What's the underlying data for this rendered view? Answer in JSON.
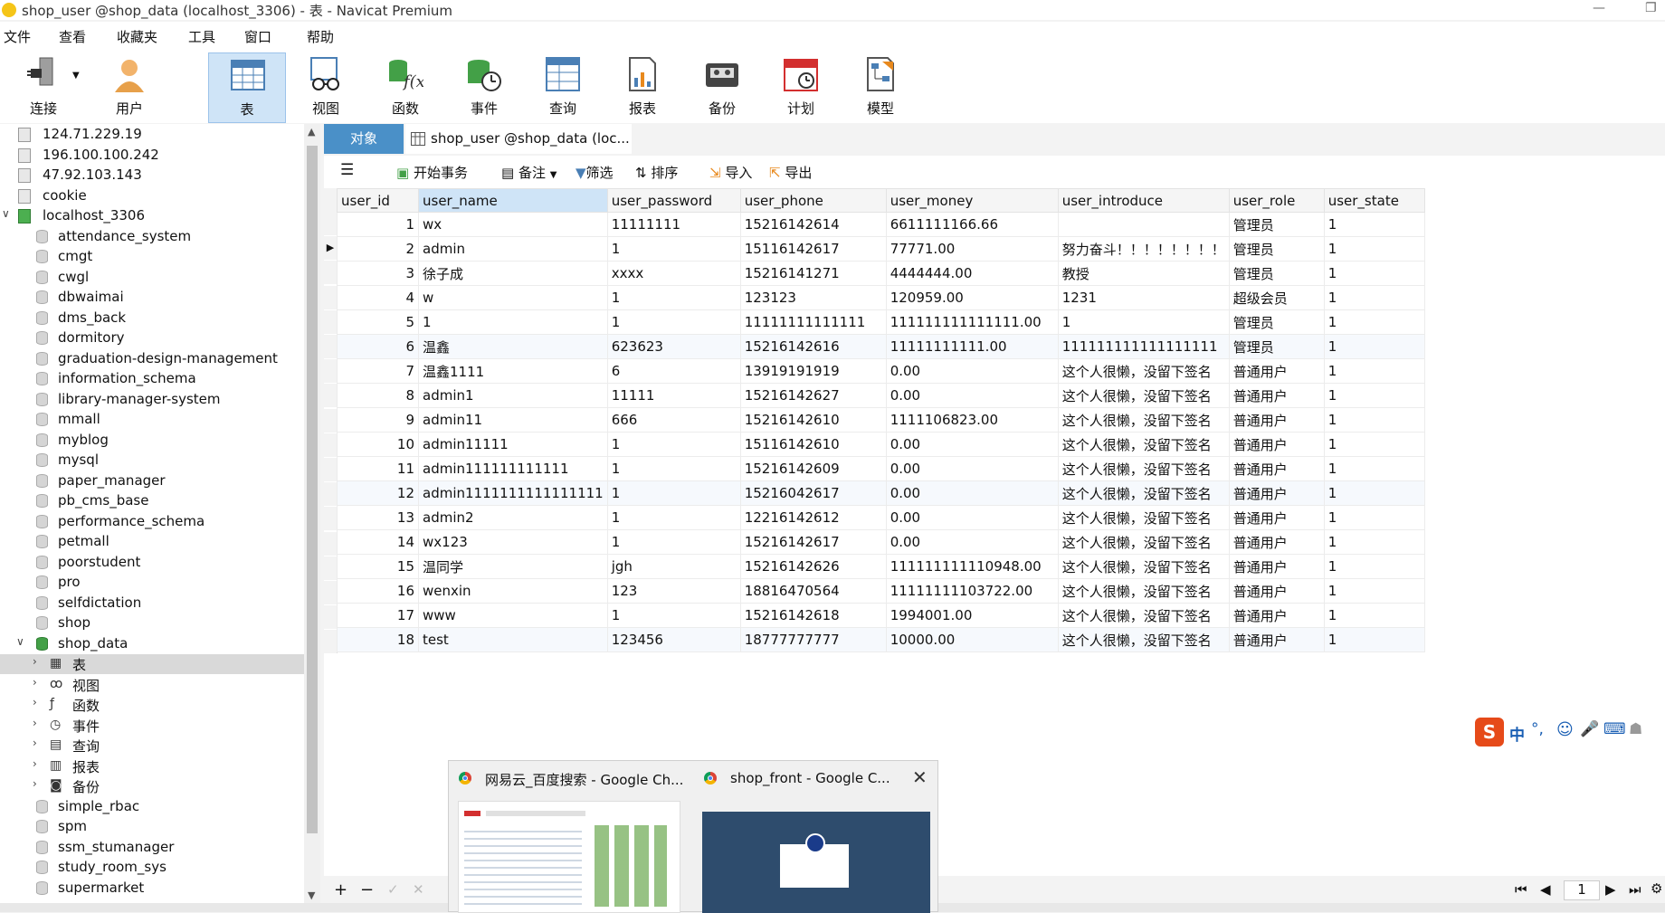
{
  "window": {
    "title": "shop_user @shop_data (localhost_3306) - 表 - Navicat Premium"
  },
  "menu": [
    "文件",
    "查看",
    "收藏夹",
    "工具",
    "窗口",
    "帮助"
  ],
  "toolbar": {
    "connect": "连接",
    "user": "用户",
    "table": "表",
    "view": "视图",
    "function": "函数",
    "event": "事件",
    "query": "查询",
    "report": "报表",
    "backup": "备份",
    "schedule": "计划",
    "model": "模型"
  },
  "tree": {
    "connections": [
      "124.71.229.19",
      "196.100.100.242",
      "47.92.103.143",
      "cookie",
      "localhost_3306"
    ],
    "databases_a": [
      "attendance_system",
      "cmgt",
      "cwgl",
      "dbwaimai",
      "dms_back",
      "dormitory",
      "graduation-design-management",
      "information_schema",
      "library-manager-system",
      "mmall",
      "myblog",
      "mysql",
      "paper_manager",
      "pb_cms_base",
      "performance_schema",
      "petmall",
      "poorstudent",
      "pro",
      "selfdictation",
      "shop",
      "shop_data"
    ],
    "shop_data_children": [
      "表",
      "视图",
      "函数",
      "事件",
      "查询",
      "报表",
      "备份"
    ],
    "databases_b": [
      "simple_rbac",
      "spm",
      "ssm_stumanager",
      "study_room_sys",
      "supermarket"
    ]
  },
  "tabs": {
    "objects": "对象",
    "doc": "shop_user @shop_data (loc..."
  },
  "gridbar": {
    "begin_tx": "开始事务",
    "note": "备注",
    "filter": "筛选",
    "sort": "排序",
    "import": "导入",
    "export": "导出"
  },
  "table": {
    "columns": [
      "user_id",
      "user_name",
      "user_password",
      "user_phone",
      "user_money",
      "user_introduce",
      "user_role",
      "user_state"
    ],
    "rows": [
      [
        "1",
        "wx",
        "11111111",
        "15216142614",
        "6611111166.66",
        "",
        "管理员",
        "1"
      ],
      [
        "2",
        "admin",
        "1",
        "15116142617",
        "77771.00",
        "努力奋斗！！！！！！！！",
        "管理员",
        "1"
      ],
      [
        "3",
        "徐子成",
        "xxxx",
        "15216141271",
        "4444444.00",
        "教授",
        "管理员",
        "1"
      ],
      [
        "4",
        "w",
        "1",
        "123123",
        "120959.00",
        "1231",
        "超级会员",
        "1"
      ],
      [
        "5",
        "1",
        "1",
        "11111111111111",
        "111111111111111.00",
        "1",
        "管理员",
        "1"
      ],
      [
        "6",
        "温鑫",
        "623623",
        "15216142616",
        "11111111111.00",
        "111111111111111111",
        "管理员",
        "1"
      ],
      [
        "7",
        "温鑫1111",
        "6",
        "13919191919",
        "0.00",
        "这个人很懒，没留下签名",
        "普通用户",
        "1"
      ],
      [
        "8",
        "admin1",
        "11111",
        "15216142627",
        "0.00",
        "这个人很懒，没留下签名",
        "普通用户",
        "1"
      ],
      [
        "9",
        "admin11",
        "666",
        "15216142610",
        "1111106823.00",
        "这个人很懒，没留下签名",
        "普通用户",
        "1"
      ],
      [
        "10",
        "admin11111",
        "1",
        "15116142610",
        "0.00",
        "这个人很懒，没留下签名",
        "普通用户",
        "1"
      ],
      [
        "11",
        "admin111111111111",
        "1",
        "15216142609",
        "0.00",
        "这个人很懒，没留下签名",
        "普通用户",
        "1"
      ],
      [
        "12",
        "admin1111111111111111",
        "1",
        "15216042617",
        "0.00",
        "这个人很懒，没留下签名",
        "普通用户",
        "1"
      ],
      [
        "13",
        "admin2",
        "1",
        "12216142612",
        "0.00",
        "这个人很懒，没留下签名",
        "普通用户",
        "1"
      ],
      [
        "14",
        "wx123",
        "1",
        "15216142617",
        "0.00",
        "这个人很懒，没留下签名",
        "普通用户",
        "1"
      ],
      [
        "15",
        "温同学",
        "jgh",
        "15216142626",
        "111111111110948.00",
        "这个人很懒，没留下签名",
        "普通用户",
        "1"
      ],
      [
        "16",
        "wenxin",
        "123",
        "18816470564",
        "11111111103722.00",
        "这个人很懒，没留下签名",
        "普通用户",
        "1"
      ],
      [
        "17",
        "www",
        "1",
        "15216142618",
        "1994001.00",
        "这个人很懒，没留下签名",
        "普通用户",
        "1"
      ],
      [
        "18",
        "test",
        "123456",
        "18777777777",
        "10000.00",
        "这个人很懒，没留下签名",
        "普通用户",
        "1"
      ]
    ]
  },
  "pager": {
    "page": "1"
  },
  "taskbar_popup": {
    "left_title": "网易云_百度搜索 - Google Ch...",
    "right_title": "shop_front - Google C..."
  },
  "ime": {
    "mode": "中"
  },
  "colors": {
    "tab_active": "#4a90c8",
    "selected_tool": "#cfe4f7",
    "connection_on": "#4caf50"
  }
}
